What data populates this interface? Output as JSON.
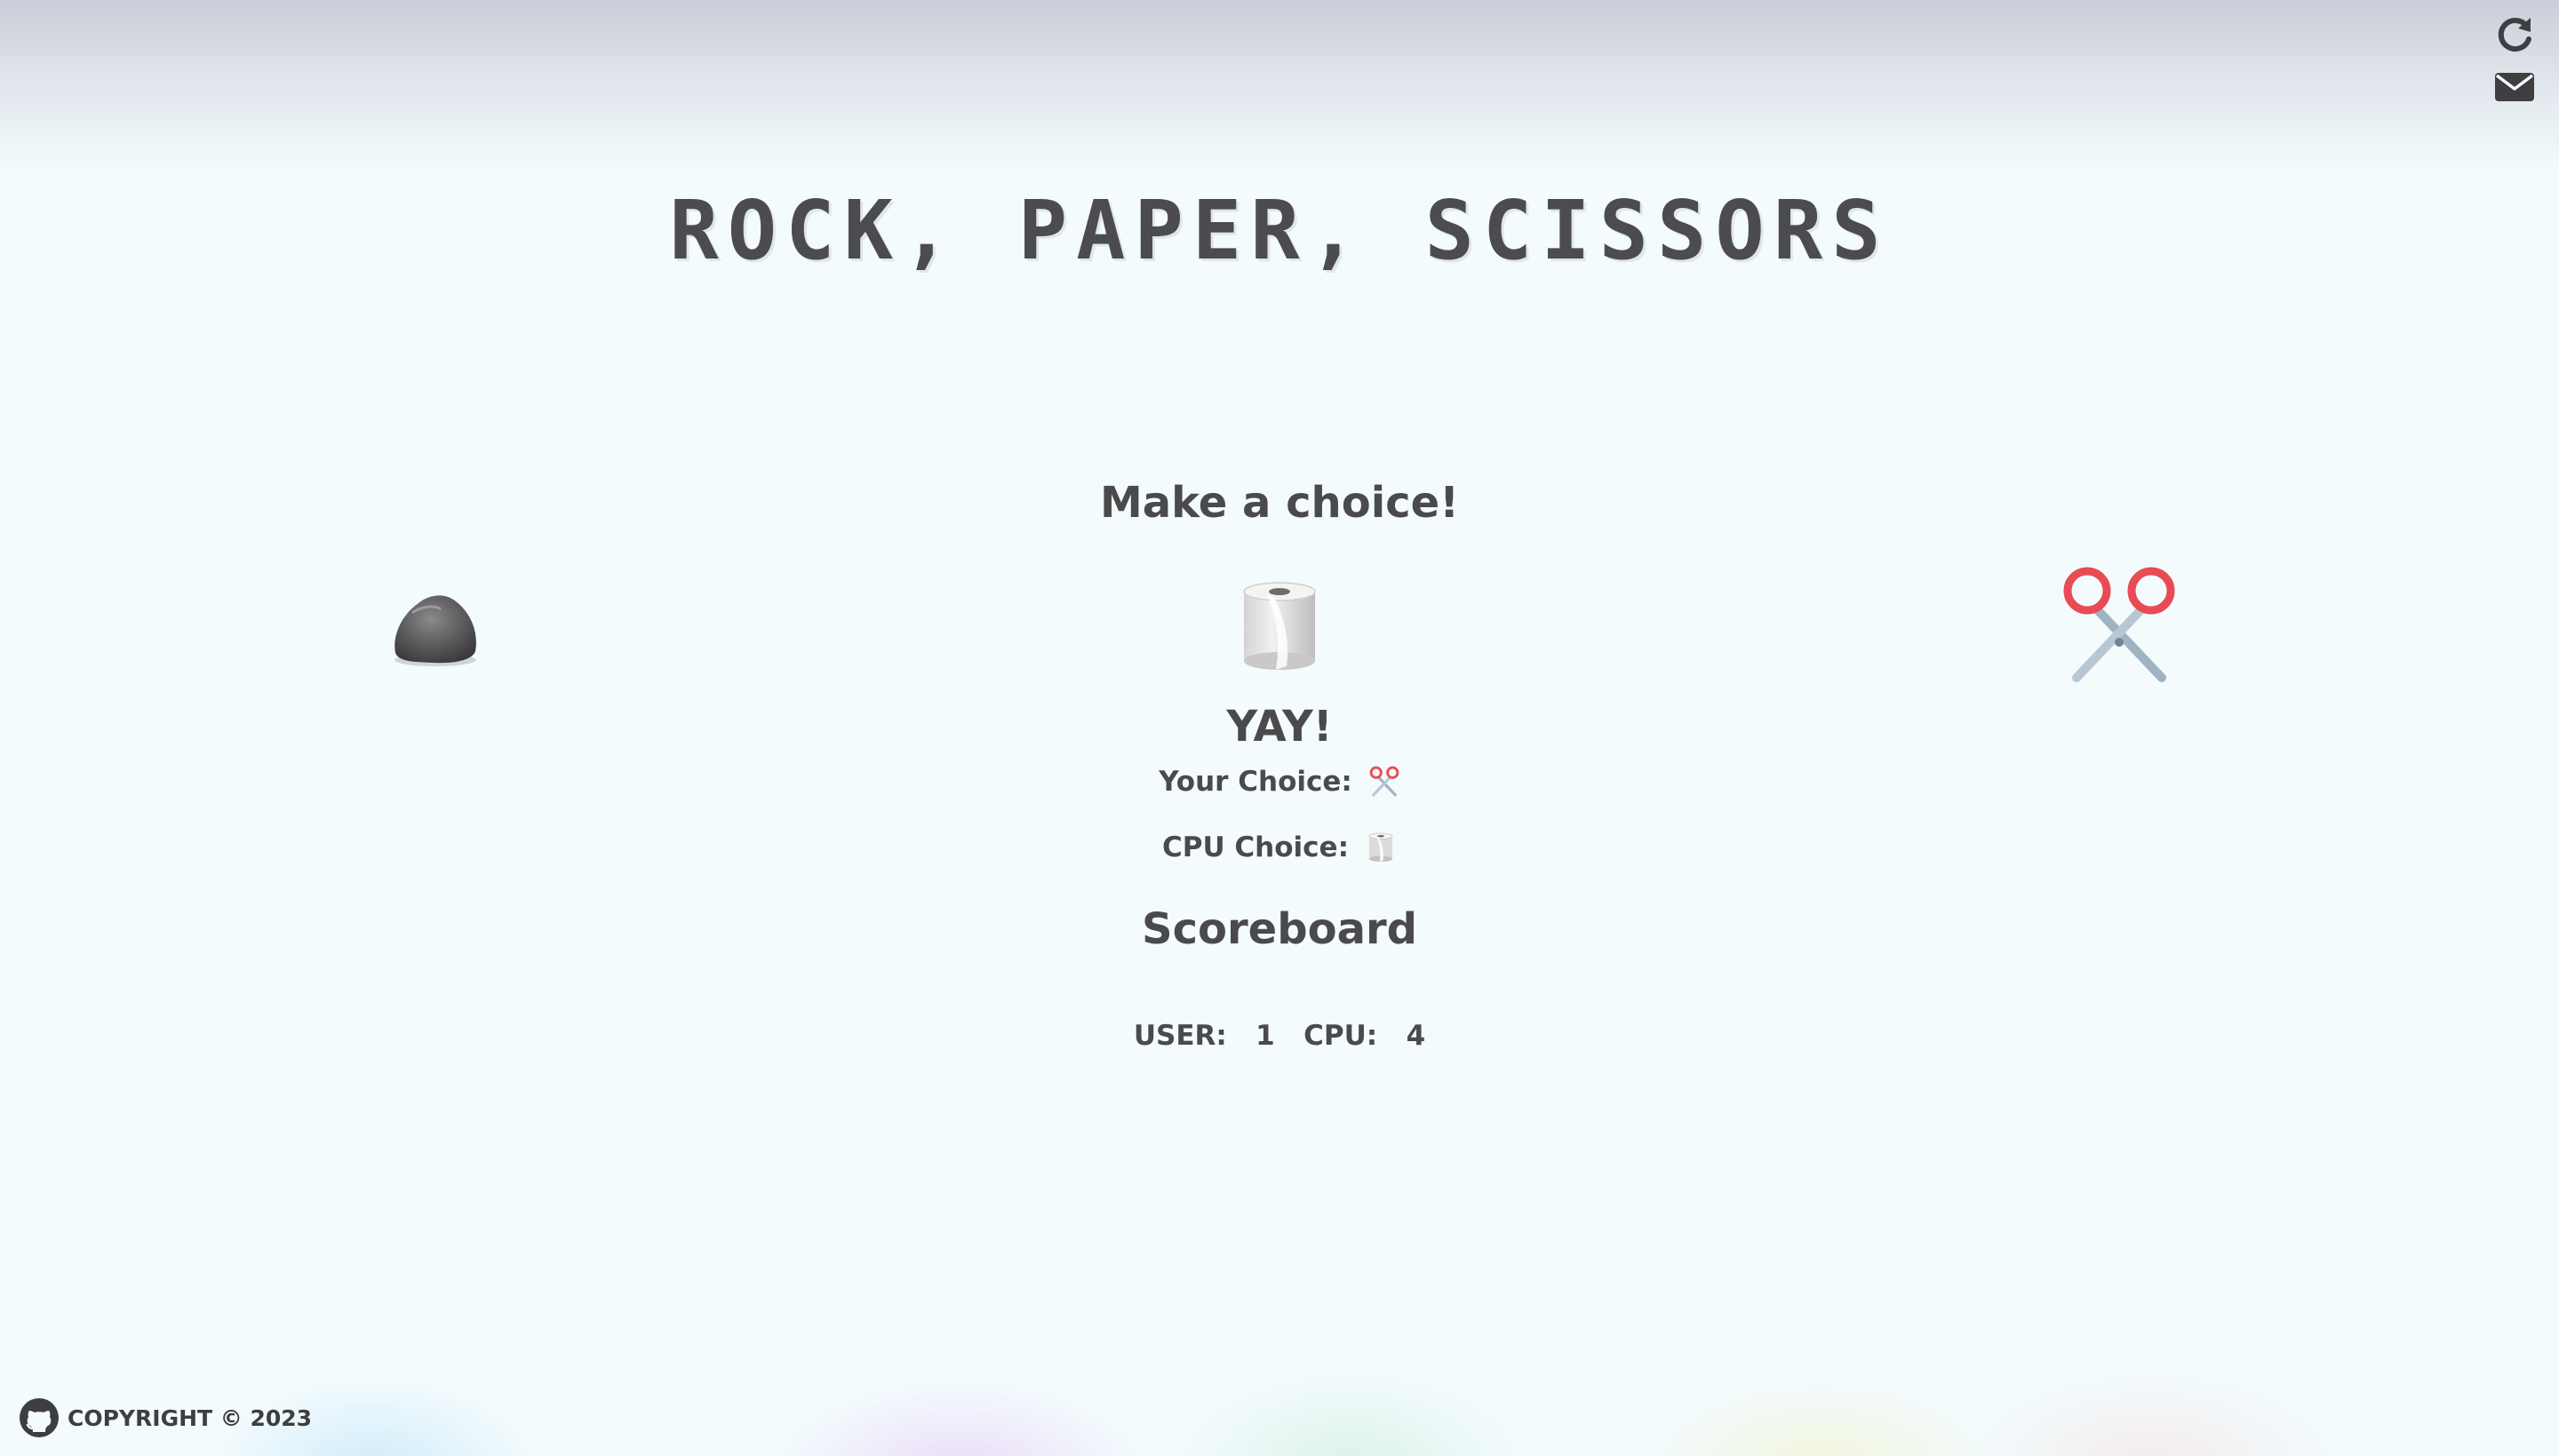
{
  "header": {
    "title": "Rock, Paper, Scissors",
    "icons": [
      "refresh-icon",
      "mail-icon"
    ]
  },
  "game": {
    "prompt": "Make a choice!",
    "choices": [
      {
        "name": "rock",
        "icon": "rock-icon"
      },
      {
        "name": "paper",
        "icon": "toilet-paper-icon"
      },
      {
        "name": "scissors",
        "icon": "scissors-icon"
      }
    ],
    "result": "YAY!",
    "your_choice_label": "Your Choice:",
    "your_choice_icon": "scissors-icon",
    "cpu_choice_label": "CPU Choice:",
    "cpu_choice_icon": "toilet-paper-icon"
  },
  "scoreboard": {
    "title": "Scoreboard",
    "user_label": "USER:",
    "user_score": "1",
    "cpu_label": "CPU:",
    "cpu_score": "4"
  },
  "footer": {
    "copyright": "COPYRIGHT © 2023",
    "icon": "github-icon"
  },
  "colors": {
    "background": "#f3fbfd",
    "text": "#4a4a4c",
    "scissors_handle": "#e94b55",
    "blade": "#9fb3c2"
  }
}
